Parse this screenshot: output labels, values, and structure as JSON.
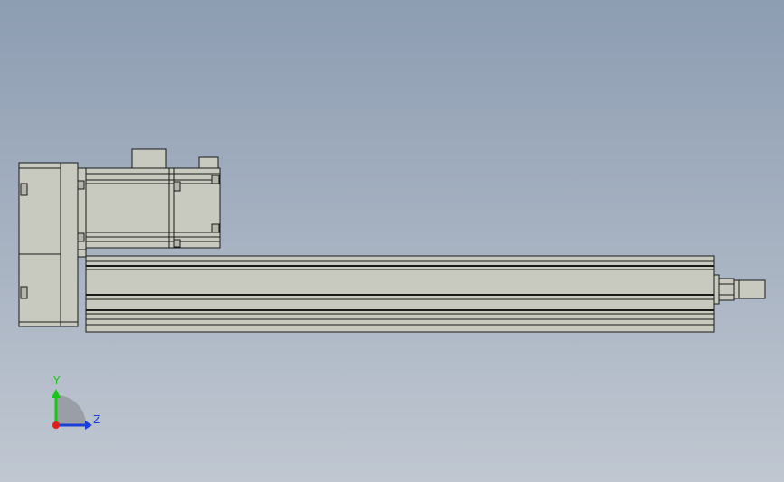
{
  "view": {
    "background_top": "#8d9db2",
    "background_bottom": "#c0c7d1",
    "part_fill": "#c8c9bf",
    "edge_color": "#1a1a1a"
  },
  "triad": {
    "y_label": "Y",
    "z_label": "Z",
    "y_color": "#14c814",
    "z_color": "#1a3fd6",
    "x_color": "#e01c1c"
  }
}
